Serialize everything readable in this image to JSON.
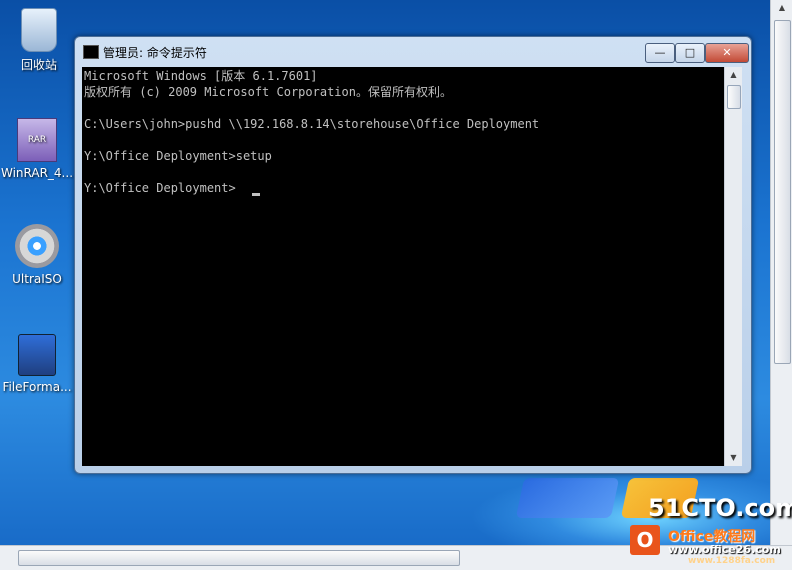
{
  "desktop": {
    "icons": [
      {
        "name": "recycle-bin",
        "label": "回收站"
      },
      {
        "name": "winrar",
        "label": "WinRAR_4...",
        "badge": "RAR"
      },
      {
        "name": "ultraiso",
        "label": "UltraISO"
      },
      {
        "name": "fileformat",
        "label": "FileForma..."
      }
    ]
  },
  "window": {
    "title": "管理员: 命令提示符",
    "buttons": {
      "minimize": "—",
      "maximize": "□",
      "close": "✕"
    }
  },
  "console": {
    "lines": [
      "Microsoft Windows [版本 6.1.7601]",
      "版权所有 (c) 2009 Microsoft Corporation。保留所有权利。",
      "",
      "C:\\Users\\john>pushd \\\\192.168.8.14\\storehouse\\Office Deployment",
      "",
      "Y:\\Office Deployment>setup",
      "",
      "Y:\\Office Deployment>"
    ]
  },
  "scrollbars": {
    "up": "▲",
    "down": "▼"
  },
  "watermarks": {
    "site1": "51CTO.com",
    "site2": "Office教程网",
    "site3": "www.office26.com",
    "site4": "www.1288fa.com",
    "office_logo": "O"
  }
}
